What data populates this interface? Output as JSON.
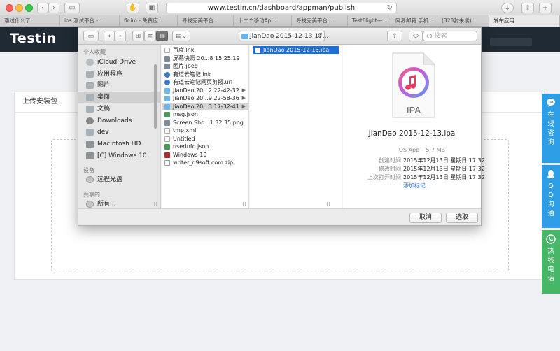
{
  "browser": {
    "url": "www.testin.cn/dashboard/appman/publish",
    "tabs": [
      {
        "label": "通过什么了",
        "w": 86
      },
      {
        "label": "ios 测试平台 -...",
        "w": 85
      },
      {
        "label": "fir.im - 免费应...",
        "w": 83
      },
      {
        "label": "寻找完美平台...",
        "w": 80
      },
      {
        "label": "十二个移动Ap...",
        "w": 83
      },
      {
        "label": "寻找完美平台...",
        "w": 80
      },
      {
        "label": "TestFlight—...",
        "w": 62
      },
      {
        "label": "网易邮箱 手机...",
        "w": 66
      },
      {
        "label": "(323封未读)...",
        "w": 74
      },
      {
        "label": "发布应用",
        "w": 101,
        "active": true
      }
    ]
  },
  "site": {
    "logo": "Testin",
    "panel_title": "上传安装包",
    "side_service": {
      "online": "在线咨询",
      "qq": "QQ沟通",
      "hotline": "热线电话"
    }
  },
  "dialog": {
    "path": "JianDao 2015-12-13 17...",
    "search_placeholder": "搜索",
    "sidebar": {
      "favorites_header": "个人收藏",
      "favorites": [
        {
          "label": "iCloud Drive",
          "icon": "cloud"
        },
        {
          "label": "应用程序",
          "icon": "folder"
        },
        {
          "label": "图片",
          "icon": "folder"
        },
        {
          "label": "桌面",
          "icon": "folder",
          "selected": true
        },
        {
          "label": "文稿",
          "icon": "folder"
        },
        {
          "label": "Downloads",
          "icon": "dl"
        },
        {
          "label": "dev",
          "icon": "folder"
        },
        {
          "label": "Macintosh HD",
          "icon": "disk"
        },
        {
          "label": "[C] Windows 10",
          "icon": "disk"
        }
      ],
      "devices_header": "设备",
      "devices": [
        {
          "label": "远程光盘",
          "icon": "disc"
        }
      ],
      "shared_header": "共享的",
      "shared": [
        {
          "label": "所有...",
          "icon": "disc"
        }
      ]
    },
    "column1": [
      {
        "name": "百度.lnk",
        "kind": "txt"
      },
      {
        "name": "屏幕快照 20...8 15.25.19",
        "kind": "img"
      },
      {
        "name": "图片.jpeg",
        "kind": "img"
      },
      {
        "name": "有道云笔记.lnk",
        "kind": "url"
      },
      {
        "name": "有道云笔记网页剪报.url",
        "kind": "url"
      },
      {
        "name": "JianDao 20...2 22-42-32",
        "kind": "dir",
        "folder": true
      },
      {
        "name": "JianDao 20...9 22-58-36",
        "kind": "dir",
        "folder": true
      },
      {
        "name": "JianDao 20...3 17-32-41",
        "kind": "dir",
        "folder": true,
        "selected": true
      },
      {
        "name": "msg.json",
        "kind": "json"
      },
      {
        "name": "Screen Sho...1.32.35.png",
        "kind": "img"
      },
      {
        "name": "tmp.xml",
        "kind": "txt"
      },
      {
        "name": "Untitled",
        "kind": "txt"
      },
      {
        "name": "userInfo.json",
        "kind": "json"
      },
      {
        "name": "Windows 10",
        "kind": "win"
      },
      {
        "name": "writer_d9soft.com.zip",
        "kind": "zip"
      }
    ],
    "column2_selected": "JianDao 2015-12-13.ipa",
    "preview": {
      "icon_label": "IPA",
      "name": "JianDao 2015-12-13.ipa",
      "kind": "iOS App – 5.7 MB",
      "created_label": "创建时间",
      "created": "2015年12月13日 星期日 17:32",
      "modified_label": "修改时间",
      "modified": "2015年12月13日 星期日 17:32",
      "opened_label": "上次打开时间",
      "opened": "2015年12月13日 星期日 17:32",
      "add_tags": "添加标记…"
    },
    "cancel": "取消",
    "choose": "选取"
  },
  "colors": {
    "accent": "#1f6fd6",
    "service_blue": "#2d9de6",
    "service_green": "#47b667",
    "site_header": "#202a34"
  }
}
